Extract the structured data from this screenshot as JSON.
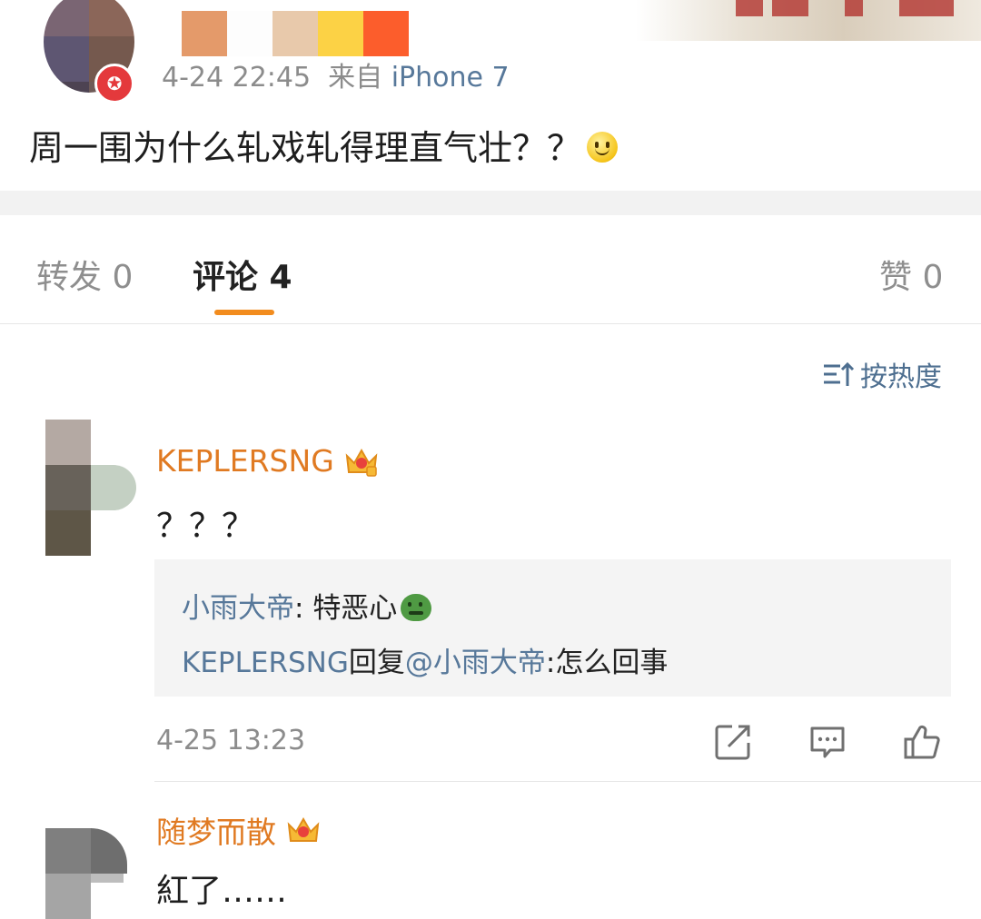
{
  "post": {
    "time": "4-24 22:45",
    "source_prefix": "来自",
    "source": "iPhone 7",
    "text": "周一围为什么轧戏轧得理直气壮？？"
  },
  "tabs": [
    {
      "label": "转发 0"
    },
    {
      "label": "评论 4"
    },
    {
      "label": "赞 0"
    }
  ],
  "sort": {
    "label": "按热度"
  },
  "comments": [
    {
      "name": "KEPLERSNG",
      "text": "？？？",
      "replies": [
        {
          "author": "小雨大帝",
          "sep": ": ",
          "text": "特恶心"
        },
        {
          "author": "KEPLERSNG",
          "mid": "回复",
          "mention": "@小雨大帝",
          "text": ":怎么回事"
        }
      ],
      "time": "4-25 13:23"
    },
    {
      "name": "随梦而散",
      "text": "紅了……"
    }
  ],
  "colors": {
    "accent": "#f28c1e",
    "link": "#57789a",
    "username": "#e07a22"
  }
}
